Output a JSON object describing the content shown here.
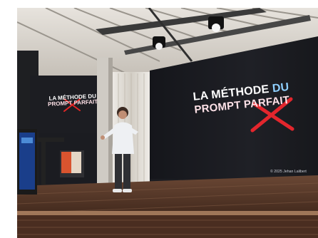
{
  "photo": {
    "description_scene": "speaker on stage",
    "slide": {
      "line1_a": "LA MÉTHODE",
      "line1_b": "DU",
      "line2": "PROMPT PARFAIT",
      "copyright": "© 2025 Jehan Lalibert"
    },
    "small_slide": {
      "line1": "LA MÉTHODE DU",
      "line2": "PROMPT PARFAIT"
    }
  },
  "colors": {
    "stage_floor": "#5b3b2c",
    "screen_bg": "#1d1e23",
    "ceiling": "#d9d6d1",
    "cross_red": "#e32626",
    "accent_blue": "#8fd0ff"
  },
  "icons": [
    "spotlight-icon",
    "red-cross-mark"
  ]
}
